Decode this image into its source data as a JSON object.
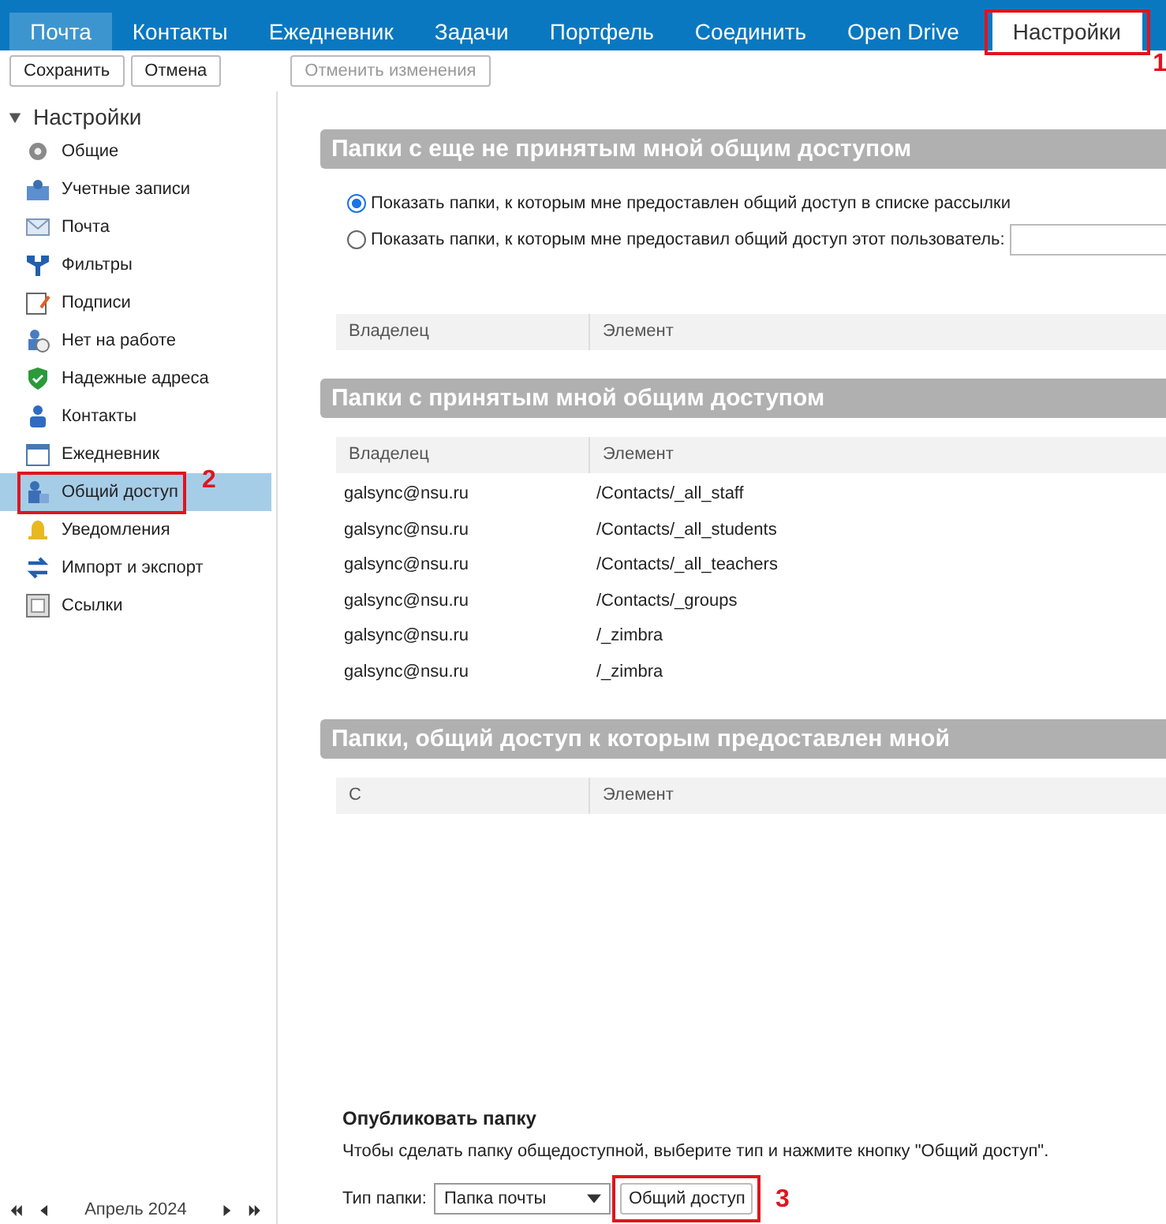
{
  "tabs": [
    {
      "label": "Почта",
      "selected": false,
      "current": true
    },
    {
      "label": "Контакты",
      "selected": false,
      "current": false
    },
    {
      "label": "Ежедневник",
      "selected": false,
      "current": false
    },
    {
      "label": "Задачи",
      "selected": false,
      "current": false
    },
    {
      "label": "Портфель",
      "selected": false,
      "current": false
    },
    {
      "label": "Соединить",
      "selected": false,
      "current": false
    },
    {
      "label": "Open Drive",
      "selected": false,
      "current": false
    },
    {
      "label": "Настройки",
      "selected": true,
      "current": false,
      "callout": "1"
    }
  ],
  "toolbar": {
    "save": "Сохранить",
    "cancel": "Отмена",
    "revert": {
      "label": "Отменить изменения",
      "disabled": true
    }
  },
  "sidebar": {
    "title": "Настройки",
    "expanded": true,
    "items": [
      {
        "label": "Общие",
        "selected": false
      },
      {
        "label": "Учетные записи",
        "selected": false
      },
      {
        "label": "Почта",
        "selected": false
      },
      {
        "label": "Фильтры",
        "selected": false
      },
      {
        "label": "Подписи",
        "selected": false
      },
      {
        "label": "Нет на работе",
        "selected": false
      },
      {
        "label": "Надежные адреса",
        "selected": false
      },
      {
        "label": "Контакты",
        "selected": false
      },
      {
        "label": "Ежедневник",
        "selected": false
      },
      {
        "label": "Общий доступ",
        "selected": true,
        "callout": "2"
      },
      {
        "label": "Уведомления",
        "selected": false
      },
      {
        "label": "Импорт и экспорт",
        "selected": false
      },
      {
        "label": "Ссылки",
        "selected": false
      }
    ]
  },
  "mini_calendar": {
    "month": "Апрель 2024"
  },
  "sections": [
    {
      "title": "Папки с еще не принятым мной общим доступом",
      "radios": [
        {
          "label": "Показать папки, к которым мне предоставлен общий доступ в списке рассылки",
          "selected": true,
          "kind": "plain"
        },
        {
          "label": "Показать папки, к которым мне предоставил общий доступ этот пользователь:",
          "selected": false,
          "kind": "user"
        }
      ],
      "columns": [
        "Владелец",
        "Элемент"
      ]
    },
    {
      "title": "Папки с принятым мной общим доступом",
      "columns": [
        "Владелец",
        "Элемент"
      ],
      "rows": [
        [
          "galsync@nsu.ru",
          "/Contacts/_all_staff"
        ],
        [
          "galsync@nsu.ru",
          "/Contacts/_all_students"
        ],
        [
          "galsync@nsu.ru",
          "/Contacts/_all_teachers"
        ],
        [
          "galsync@nsu.ru",
          "/Contacts/_groups"
        ],
        [
          "galsync@nsu.ru",
          "/_zimbra"
        ],
        [
          "galsync@nsu.ru",
          "/_zimbra"
        ]
      ]
    },
    {
      "title": "Папки, общий доступ к которым предоставлен мной",
      "columns": [
        "С",
        "Элемент"
      ]
    }
  ],
  "publish": {
    "title": "Опубликовать папку",
    "description": "Чтобы сделать папку общедоступной, выберите тип и нажмите кнопку \"Общий доступ\".",
    "type_label": "Тип папки:",
    "type_value": "Папка почты",
    "button": "Общий доступ",
    "callout": "3"
  }
}
